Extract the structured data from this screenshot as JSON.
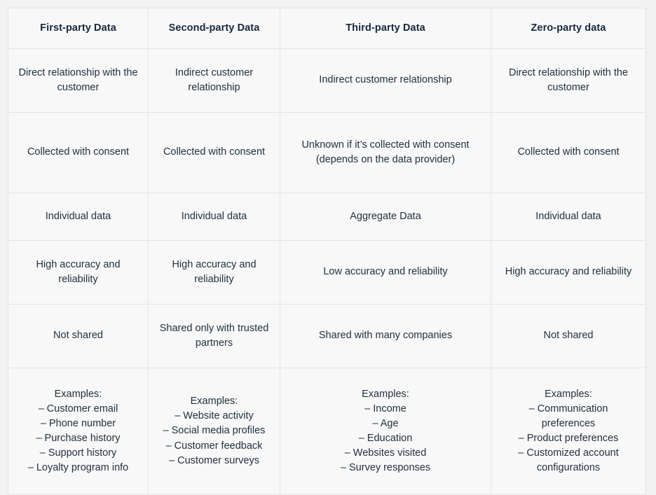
{
  "table": {
    "headers": [
      "First-party Data",
      "Second-party Data",
      "Third-party Data",
      "Zero-party data"
    ],
    "rows": [
      {
        "id": "relationship",
        "cells": [
          "Direct relationship with the customer",
          "Indirect customer relationship",
          "Indirect customer relationship",
          "Direct relationship with the customer"
        ]
      },
      {
        "id": "consent",
        "cells": [
          "Collected with consent",
          "Collected with consent",
          "Unknown if it’s collected with consent (depends on the data provider)",
          "Collected with consent"
        ]
      },
      {
        "id": "granularity",
        "cells": [
          "Individual data",
          "Individual data",
          "Aggregate Data",
          "Individual data"
        ]
      },
      {
        "id": "accuracy",
        "cells": [
          "High accuracy and reliability",
          "High accuracy and reliability",
          "Low accuracy and reliability",
          "High accuracy and reliability"
        ]
      },
      {
        "id": "sharing",
        "cells": [
          "Not shared",
          "Shared only with trusted partners",
          "Shared with many companies",
          "Not shared"
        ]
      }
    ],
    "examples_row": {
      "id": "examples",
      "label": "Examples:",
      "columns": [
        {
          "title": "Examples:",
          "items": [
            "– Customer email",
            "– Phone number",
            "– Purchase history",
            "– Support history",
            "– Loyalty program info"
          ]
        },
        {
          "title": "Examples:",
          "items": [
            "– Website activity",
            "– Social media profiles",
            "– Customer feedback",
            "– Customer surveys"
          ]
        },
        {
          "title": "Examples:",
          "items": [
            "– Income",
            "– Age",
            "– Education",
            "– Websites visited",
            "– Survey responses"
          ]
        },
        {
          "title": "Examples:",
          "items": [
            "– Communication preferences",
            "– Product preferences",
            "– Customized account configurations"
          ]
        }
      ]
    }
  },
  "colors": {
    "page_background": "#f2f2f2",
    "cell_background": "#f8f8f8",
    "border": "#e4e4e4",
    "outer_border": "#dcdcdc",
    "header_text": "#16283e",
    "body_text": "#22303f"
  }
}
